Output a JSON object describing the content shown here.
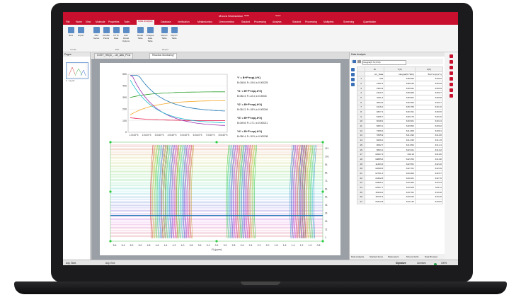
{
  "app": {
    "title": "Mnova Workstation"
  },
  "tabs": [
    "File",
    "Home",
    "View",
    "Molecule",
    "Properties",
    "Tools",
    "Data Analysis",
    "Database",
    "Verification",
    "Metabolomics",
    "Chemometrics",
    "Stacked",
    "Processing",
    "Analysis",
    "Stacked",
    "Processing",
    "Multiplets",
    "Screening",
    "Quantitation"
  ],
  "context_labels": [
    "NMR",
    "Stack"
  ],
  "ribbon": {
    "buttons": [
      "New",
      "Import",
      "Add Series",
      "Double Points",
      "Fit To Data",
      "Edit Model Options",
      "Model Table",
      "Arrayed Data Table",
      "Report Table",
      "Report Table"
    ],
    "groups": [
      "Create",
      "Edit",
      "Report"
    ]
  },
  "left_panel": {
    "title": "Pages",
    "thumb_label": "1 - H_rxn"
  },
  "doc_tabs": [
    "COSY_HSQC_...de_dark_PCA",
    "Reaction Monitoring*"
  ],
  "right_panel": {
    "title": "Data Analysis",
    "combo": "Integral(5.79,5.54)",
    "columns": [
      "",
      "ID",
      "Y(X)",
      "F(X)"
    ],
    "formula_header": [
      "",
      "Arr_Data",
      "Integral(5.7923)",
      "B+F*exp(-k*x)"
    ],
    "rows": [
      [
        "1",
        "601",
        "338.660",
        "333.02"
      ],
      [
        "2",
        "1251.6",
        "338.640",
        "335.99"
      ],
      [
        "3",
        "1903.9",
        "339.691",
        "339.69"
      ],
      [
        "4",
        "2419.7",
        "339.680",
        "339.67"
      ],
      [
        "5",
        "3011.3",
        "339.861",
        "339.58"
      ],
      [
        "6",
        "3603.6",
        "340.060",
        "340.07"
      ],
      [
        "7",
        "4216.2",
        "339.780",
        "340.10"
      ],
      [
        "8",
        "4827.2",
        "340.291",
        "340.00"
      ],
      [
        "9",
        "5436.7",
        "340.270",
        "340.40"
      ],
      [
        "10",
        "6048.2",
        "340.661",
        "340.44"
      ],
      [
        "11",
        "6653.1",
        "340.852",
        "340.62"
      ],
      [
        "12",
        "7259.4",
        "341.060",
        "340.81"
      ],
      [
        "13",
        "7845.9",
        "341.290",
        "341.00"
      ],
      [
        "14",
        "8449.1",
        "341.490",
        "341.19"
      ],
      [
        "15",
        "9052.7",
        "341.852",
        "341.41"
      ],
      [
        "16",
        "9663.1",
        "342.041",
        "341.62"
      ],
      [
        "17",
        "10247.4",
        "342.19",
        "341.80"
      ],
      [
        "18",
        "10885.6",
        "342.353",
        "341.98"
      ],
      [
        "19",
        "11493.2",
        "342.551",
        "342.20"
      ],
      [
        "20",
        "12099.5",
        "342.761",
        "342.39"
      ],
      [
        "21",
        "12701.3",
        "343.000",
        "342.57"
      ],
      [
        "22",
        "13302.8",
        "343.201",
        "342.76"
      ],
      [
        "23",
        "13906.1",
        "343.384",
        "342.94"
      ],
      [
        "24",
        "14507.7",
        "343.509",
        "343.11"
      ],
      [
        "25",
        "15110.2",
        "343.781",
        "343.28"
      ],
      [
        "26",
        "15711.5",
        "343.942",
        "343.46"
      ],
      [
        "27",
        "16312.8",
        "344.140",
        "343.62"
      ]
    ],
    "bottom_tabs": [
      "Data Analysis",
      "Stacked Items",
      "Parameters",
      "Mnova Verify",
      "Data Browser"
    ]
  },
  "status": {
    "left": "Avg. Start:",
    "mid": "Avg. End:",
    "signature": "Signature",
    "license": "Licenses",
    "zoom": "100%"
  },
  "equations": [
    "Y' = B+F*exp(-k*X)",
    "B=348.6; F=-19.6; k=0.000225",
    "Y1' = B+F*exp(-k*X)",
    "B=352.3; F=-22.4; k=0.00018",
    "Y2' = B+F*exp(-k*X)",
    "B=351.2; F=-18.9; k=0.000246",
    "Y3' = B+F*exp(-k*X)",
    "B=349.8; F=-17.1; k=0.000211",
    "Y4' = B+F*exp(-k*X)",
    "B=350.4; F=-20.5; k=0.000198"
  ],
  "inset_x_ticks": [
    "1.0x10^3",
    "2.0x10^3",
    "3.0x10^3",
    "4.0x10^3",
    "5.0x10^3",
    "6.0x10^3",
    "7.0x10^3",
    "8.0x10^3"
  ],
  "inset_y_ticks": [
    "500",
    "400",
    "300",
    "200",
    "100",
    "0"
  ],
  "ppm_ticks": [
    "5.6",
    "5.4",
    "5.2",
    "5.0",
    "4.8",
    "4.6",
    "4.4",
    "4.2",
    "4.0",
    "3.8",
    "3.6",
    "3.4",
    "3.2",
    "3.0",
    "2.8",
    "2.6",
    "2.4",
    "2.2",
    "2.0",
    "1.8",
    "1.6",
    "1.4",
    "1.2",
    "1.0",
    "0.8"
  ],
  "ppm_label": "f1 (ppm)",
  "stack_ticks": [
    "111",
    "101",
    "91",
    "81",
    "71",
    "61",
    "51",
    "41",
    "31",
    "21",
    "11",
    "1"
  ],
  "colors": {
    "brand": "#c8102e",
    "accent": "#3b6fb6"
  }
}
